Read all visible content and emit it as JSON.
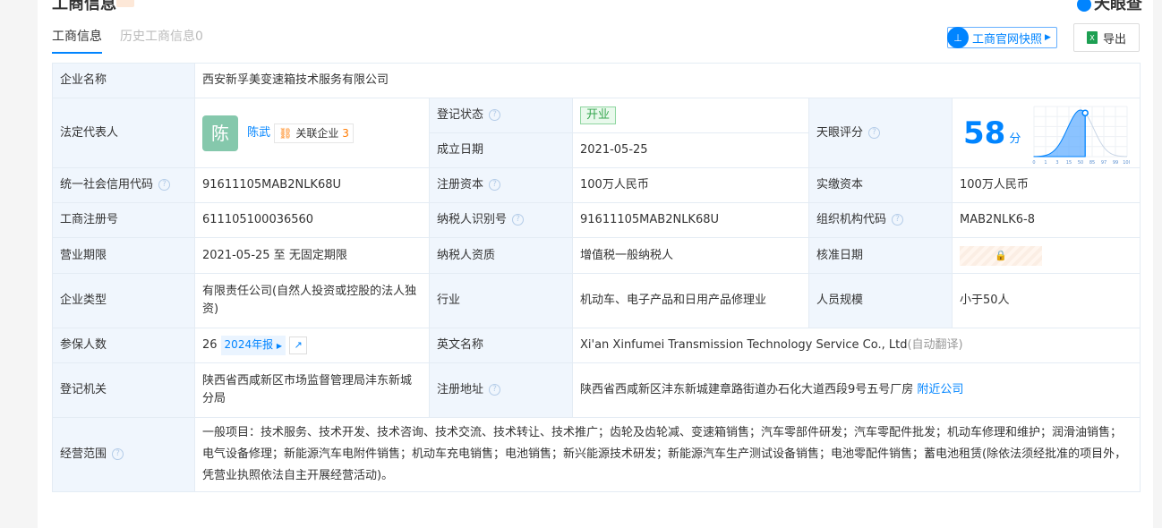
{
  "header": {
    "section_title": "工商信息",
    "logo_text": "天眼查"
  },
  "tabs": [
    {
      "label": "工商信息",
      "active": true
    },
    {
      "label": "历史工商信息0",
      "active": false
    }
  ],
  "toolbar": {
    "snapshot_label": "工商官网快照",
    "export_label": "导出"
  },
  "fields": {
    "company_name_label": "企业名称",
    "company_name": "西安新孚美变速箱技术服务有限公司",
    "legal_rep_label": "法定代表人",
    "legal_rep_avatar": "陈",
    "legal_rep_name": "陈武",
    "related_label": "关联企业",
    "related_count": "3",
    "reg_status_label": "登记状态",
    "reg_status": "开业",
    "found_date_label": "成立日期",
    "found_date": "2021-05-25",
    "score_label": "天眼评分",
    "score": "58",
    "score_unit": "分",
    "credit_code_label": "统一社会信用代码",
    "credit_code": "91611105MAB2NLK68U",
    "reg_capital_label": "注册资本",
    "reg_capital": "100万人民币",
    "paid_capital_label": "实缴资本",
    "paid_capital": "100万人民币",
    "reg_no_label": "工商注册号",
    "reg_no": "611105100036560",
    "taxpayer_id_label": "纳税人识别号",
    "taxpayer_id": "91611105MAB2NLK68U",
    "org_code_label": "组织机构代码",
    "org_code": "MAB2NLK6-8",
    "term_label": "营业期限",
    "term": "2021-05-25 至 无固定期限",
    "taxpayer_qual_label": "纳税人资质",
    "taxpayer_qual": "增值税一般纳税人",
    "approve_date_label": "核准日期",
    "type_label": "企业类型",
    "type": "有限责任公司(自然人投资或控股的法人独资)",
    "industry_label": "行业",
    "industry": "机动车、电子产品和日用产品修理业",
    "staff_label": "人员规模",
    "staff": "小于50人",
    "insured_label": "参保人数",
    "insured": "26",
    "insured_report": "2024年报",
    "en_name_label": "英文名称",
    "en_name": "Xi'an Xinfumei Transmission Technology Service Co., Ltd",
    "en_name_note": "(自动翻译)",
    "authority_label": "登记机关",
    "authority": "陕西省西咸新区市场监督管理局沣东新城分局",
    "address_label": "注册地址",
    "address": "陕西省西咸新区沣东新城建章路街道办石化大道西段9号五号厂房",
    "nearby_label": "附近公司",
    "scope_label": "经营范围",
    "scope": "一般项目：技术服务、技术开发、技术咨询、技术交流、技术转让、技术推广；齿轮及齿轮减、变速箱销售；汽车零部件研发；汽车零配件批发；机动车修理和维护；润滑油销售；电气设备修理；新能源汽车电附件销售；机动车充电销售；电池销售；新兴能源技术研发；新能源汽车生产测试设备销售；电池零配件销售；蓄电池租赁(除依法须经批准的项目外，凭营业执照依法自主开展经营活动)。"
  },
  "score_chart": {
    "ticks": [
      "0",
      "1",
      "3",
      "15",
      "50",
      "85",
      "97",
      "99",
      "100"
    ],
    "marker_percentile": 55
  }
}
